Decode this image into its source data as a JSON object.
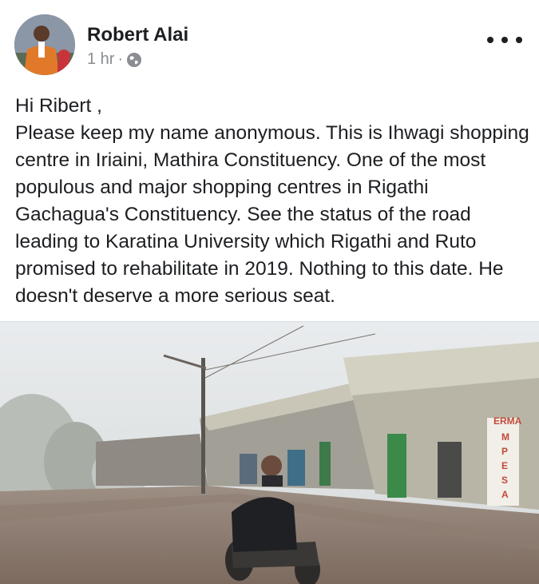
{
  "post": {
    "author": "Robert Alai",
    "time": "1 hr",
    "separator": "·",
    "privacy_icon": "globe-icon",
    "more_icon": "more-options-icon",
    "greeting": "Hi Ribert ,",
    "body": "Please keep my name anonymous. This is Ihwagi shopping centre in Iriaini, Mathira Constituency. One of the most populous and major shopping centres in Rigathi Gachagua's Constituency. See the status of the road leading to Karatina University which Rigathi and Ruto promised to rehabilitate in 2019. Nothing to this date. He doesn't deserve a more serious seat."
  },
  "photo": {
    "sign_lines": [
      "M",
      "P",
      "E",
      "S",
      "A"
    ],
    "sign_top": "ERMA"
  },
  "colors": {
    "text": "#1c1e21",
    "meta": "#8a8d91"
  }
}
